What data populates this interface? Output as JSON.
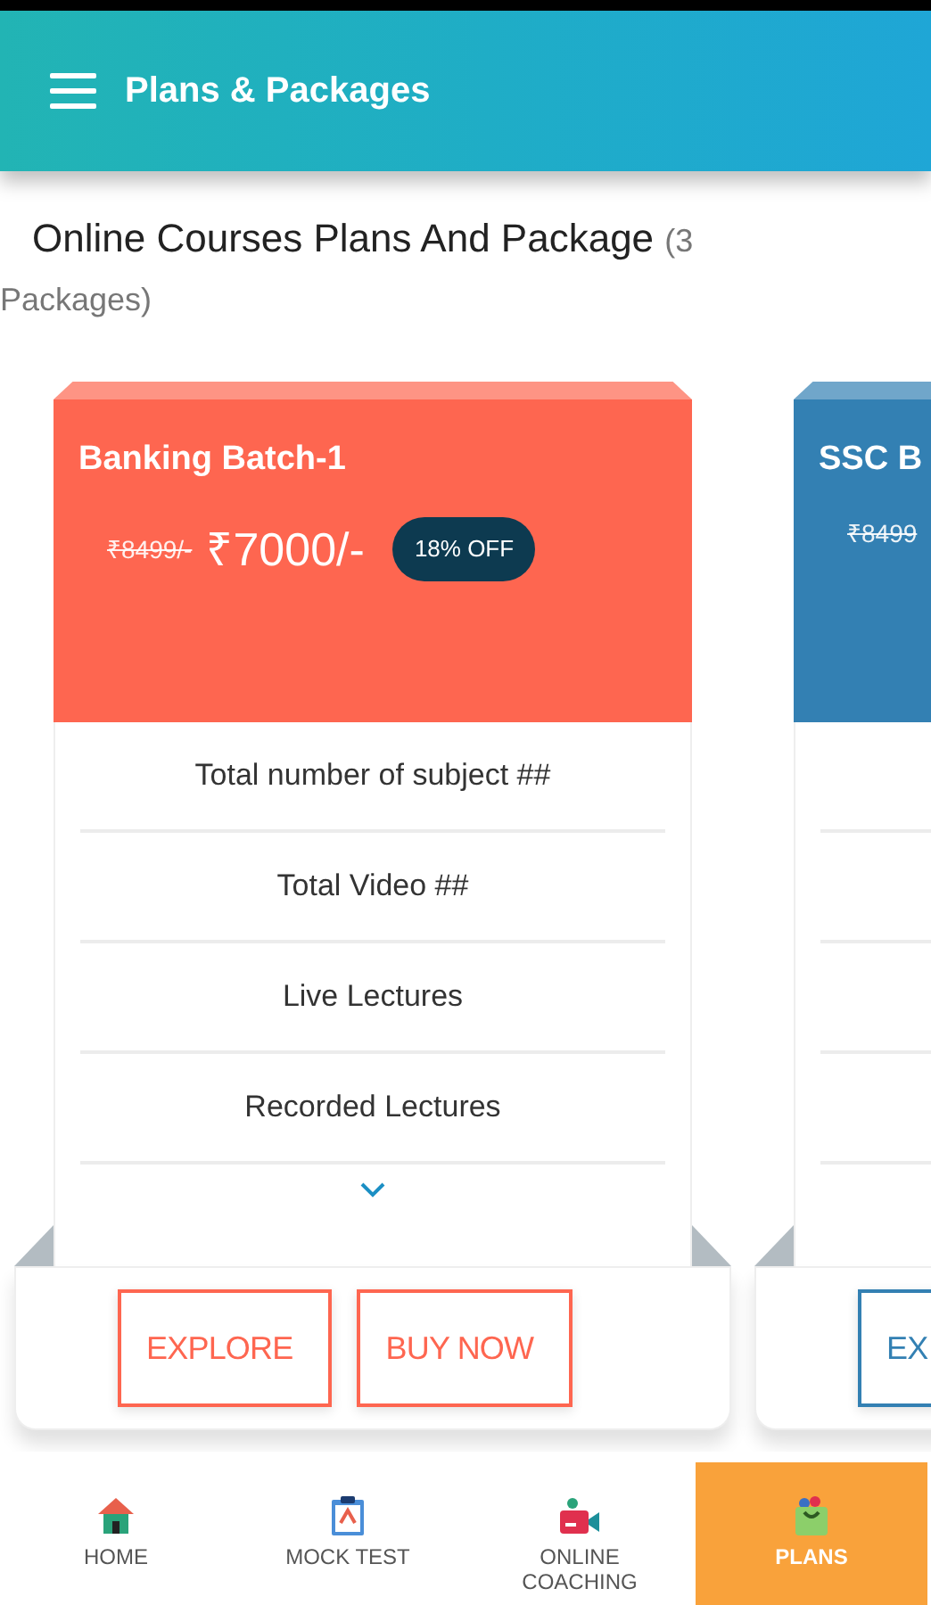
{
  "app_bar": {
    "title": "Plans & Packages"
  },
  "heading": {
    "title": "Online Courses Plans And Package",
    "count": "(3 Packages)"
  },
  "cards": [
    {
      "title": "Banking Batch-1",
      "old_price": "₹8499/-",
      "price": "₹7000/-",
      "discount": "18% OFF",
      "color": "#fe6650",
      "features": [
        "Total number of subject ##",
        "Total Video ##",
        "Live Lectures",
        "Recorded Lectures"
      ],
      "buttons": [
        "EXPLORE",
        "BUY NOW"
      ]
    },
    {
      "title": "SSC B",
      "old_price": "₹8499",
      "color": "#3380b3",
      "buttons": [
        "EX"
      ]
    }
  ],
  "bottom_nav": [
    {
      "label": "HOME",
      "selected": false
    },
    {
      "label": "MOCK TEST",
      "selected": false
    },
    {
      "label": "ONLINE COACHING",
      "selected": false
    },
    {
      "label": "PLANS",
      "selected": true
    }
  ]
}
